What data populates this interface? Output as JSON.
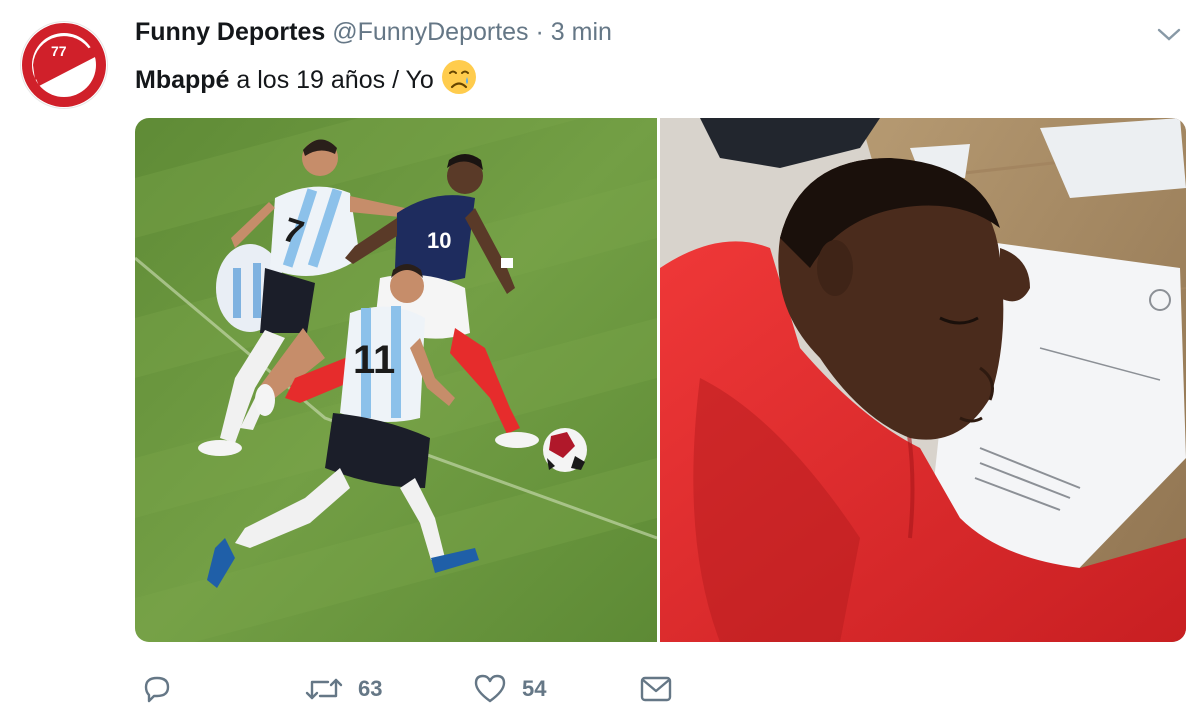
{
  "tweet": {
    "display_name": "Funny Deportes",
    "handle": "@FunnyDeportes",
    "separator": "·",
    "time": "3 min",
    "text_bold": "Mbappé",
    "text_rest": " a los 19 años / Yo",
    "emoji": "crying-face-emoji"
  },
  "actions": {
    "reply_icon": "speech-bubble-icon",
    "retweet_icon": "retweet-icon",
    "retweet_count": "63",
    "like_icon": "heart-icon",
    "like_count": "54",
    "dm_icon": "envelope-icon"
  },
  "media": {
    "left_photo_jersey_numbers": [
      "7",
      "10",
      "11"
    ],
    "colors": {
      "grass": "#6f9b42",
      "hoodie": "#d92a2a",
      "brand_red": "#d0202a"
    }
  }
}
